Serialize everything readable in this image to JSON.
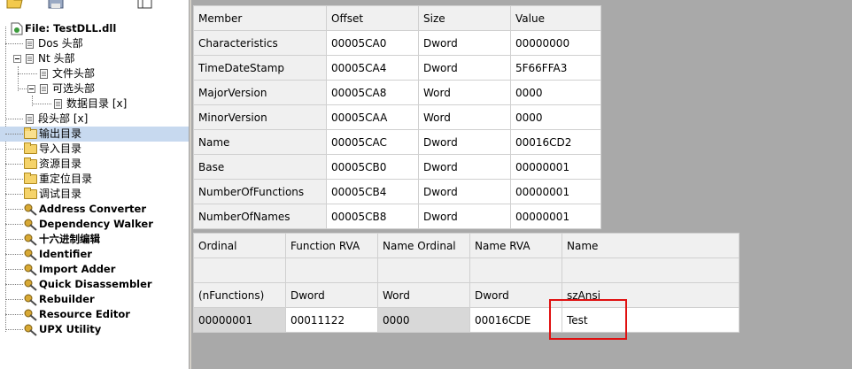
{
  "tree": {
    "root_label": "File: TestDLL.dll",
    "items": [
      {
        "label": "Dos 头部"
      },
      {
        "label": "Nt 头部"
      },
      {
        "label": "文件头部"
      },
      {
        "label": "可选头部"
      },
      {
        "label": "数据目录 [x]"
      },
      {
        "label": "段头部 [x]"
      },
      {
        "label": "输出目录"
      },
      {
        "label": "导入目录"
      },
      {
        "label": "资源目录"
      },
      {
        "label": "重定位目录"
      },
      {
        "label": "调试目录"
      },
      {
        "label": "Address Converter"
      },
      {
        "label": "Dependency Walker"
      },
      {
        "label": "十六进制编辑"
      },
      {
        "label": "Identifier"
      },
      {
        "label": "Import Adder"
      },
      {
        "label": "Quick Disassembler"
      },
      {
        "label": "Rebuilder"
      },
      {
        "label": "Resource Editor"
      },
      {
        "label": "UPX Utility"
      }
    ]
  },
  "top_table": {
    "headers": [
      "Member",
      "Offset",
      "Size",
      "Value"
    ],
    "rows": [
      [
        "Characteristics",
        "00005CA0",
        "Dword",
        "00000000"
      ],
      [
        "TimeDateStamp",
        "00005CA4",
        "Dword",
        "5F66FFA3"
      ],
      [
        "MajorVersion",
        "00005CA8",
        "Word",
        "0000"
      ],
      [
        "MinorVersion",
        "00005CAA",
        "Word",
        "0000"
      ],
      [
        "Name",
        "00005CAC",
        "Dword",
        "00016CD2"
      ],
      [
        "Base",
        "00005CB0",
        "Dword",
        "00000001"
      ],
      [
        "NumberOfFunctions",
        "00005CB4",
        "Dword",
        "00000001"
      ],
      [
        "NumberOfNames",
        "00005CB8",
        "Dword",
        "00000001"
      ]
    ]
  },
  "bottom_table": {
    "headers": [
      "Ordinal",
      "Function RVA",
      "Name Ordinal",
      "Name RVA",
      "Name"
    ],
    "blank_row": [
      "",
      "",
      "",
      "",
      ""
    ],
    "type_row": [
      "(nFunctions)",
      "Dword",
      "Word",
      "Dword",
      "szAnsi"
    ],
    "data_row": [
      "00000001",
      "00011122",
      "0000",
      "00016CDE",
      "Test"
    ]
  },
  "colors": {
    "highlight_box": "#e01010",
    "selected_tree_row": "#c7d9ef",
    "workspace_bg": "#a9a9a9"
  }
}
